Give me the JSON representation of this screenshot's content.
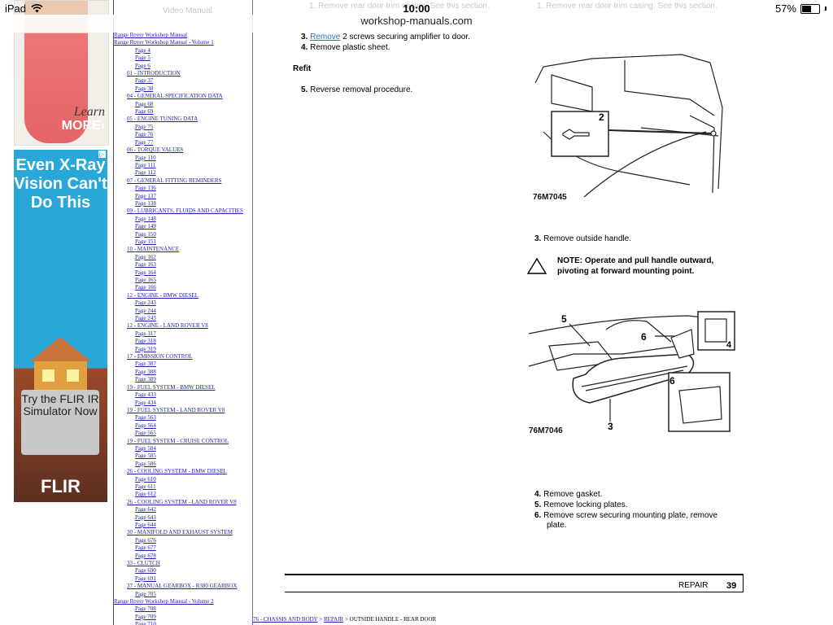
{
  "status_bar": {
    "device": "iPad",
    "time": "10:00",
    "battery": "57%",
    "battery_level": 0.57
  },
  "url_bar": {
    "domain": "workshop-manuals.com"
  },
  "ghost_text": {
    "toc_top": "Video Manual",
    "left": "1. Remove rear door trim casing. See this section.",
    "right": "1. Remove rear door trim casing. See this section."
  },
  "ads": {
    "ad1": {
      "learn": "Learn",
      "more": "MORE›"
    },
    "ad2": {
      "headline": "Even X-Ray Vision Can't Do This",
      "cta": "Try the FLIR IR Simulator Now",
      "brand": "FLIR",
      "choice": "▷"
    }
  },
  "toc": [
    {
      "text": "Range Rover Workshop Manual",
      "level": 0
    },
    {
      "text": "Range Rover Workshop Manual - Volume 1",
      "level": 0
    },
    {
      "text": "Page 4",
      "level": 2
    },
    {
      "text": "Page 5",
      "level": 2
    },
    {
      "text": "Page 6",
      "level": 2
    },
    {
      "text": "01 - INTRODUCTION",
      "level": 1
    },
    {
      "text": "Page 37",
      "level": 2
    },
    {
      "text": "Page 38",
      "level": 2
    },
    {
      "text": "04 - GENERAL SPECIFICATION DATA",
      "level": 1
    },
    {
      "text": "Page 68",
      "level": 2
    },
    {
      "text": "Page 69",
      "level": 2
    },
    {
      "text": "05 - ENGINE TUNING DATA",
      "level": 1
    },
    {
      "text": "Page 75",
      "level": 2
    },
    {
      "text": "Page 76",
      "level": 2
    },
    {
      "text": "Page 77",
      "level": 2
    },
    {
      "text": "06 - TORQUE VALUES",
      "level": 1
    },
    {
      "text": "Page 110",
      "level": 2
    },
    {
      "text": "Page 111",
      "level": 2
    },
    {
      "text": "Page 112",
      "level": 2
    },
    {
      "text": "07 - GENERAL FITTING REMINDERS",
      "level": 1
    },
    {
      "text": "Page 136",
      "level": 2
    },
    {
      "text": "Page 137",
      "level": 2
    },
    {
      "text": "Page 138",
      "level": 2
    },
    {
      "text": "09 - LUBRICANTS, FLUIDS AND CAPACITIES",
      "level": 1
    },
    {
      "text": "Page 148",
      "level": 2
    },
    {
      "text": "Page 149",
      "level": 2
    },
    {
      "text": "Page 150",
      "level": 2
    },
    {
      "text": "Page 151",
      "level": 2
    },
    {
      "text": "10 - MAINTENANCE",
      "level": 1
    },
    {
      "text": "Page 162",
      "level": 2
    },
    {
      "text": "Page 163",
      "level": 2
    },
    {
      "text": "Page 164",
      "level": 2
    },
    {
      "text": "Page 165",
      "level": 2
    },
    {
      "text": "Page 166",
      "level": 2
    },
    {
      "text": "12 - ENGINE - BMW DIESEL",
      "level": 1
    },
    {
      "text": "Page 243",
      "level": 2
    },
    {
      "text": "Page 244",
      "level": 2
    },
    {
      "text": "Page 245",
      "level": 2
    },
    {
      "text": "12 - ENGINE - LAND ROVER V8",
      "level": 1
    },
    {
      "text": "Page 317",
      "level": 2
    },
    {
      "text": "Page 318",
      "level": 2
    },
    {
      "text": "Page 319",
      "level": 2
    },
    {
      "text": "17 - EMISSION CONTROL",
      "level": 1
    },
    {
      "text": "Page 387",
      "level": 2
    },
    {
      "text": "Page 388",
      "level": 2
    },
    {
      "text": "Page 389",
      "level": 2
    },
    {
      "text": "19 - FUEL SYSTEM - BMW DIESEL",
      "level": 1
    },
    {
      "text": "Page 433",
      "level": 2
    },
    {
      "text": "Page 434",
      "level": 2
    },
    {
      "text": "19 - FUEL SYSTEM - LAND ROVER V8",
      "level": 1
    },
    {
      "text": "Page 563",
      "level": 2
    },
    {
      "text": "Page 564",
      "level": 2
    },
    {
      "text": "Page 565",
      "level": 2
    },
    {
      "text": "19 - FUEL SYSTEM - CRUISE CONTROL",
      "level": 1
    },
    {
      "text": "Page 584",
      "level": 2
    },
    {
      "text": "Page 585",
      "level": 2
    },
    {
      "text": "Page 586",
      "level": 2
    },
    {
      "text": "26 - COOLING SYSTEM - BMW DIESEL",
      "level": 1
    },
    {
      "text": "Page 610",
      "level": 2
    },
    {
      "text": "Page 611",
      "level": 2
    },
    {
      "text": "Page 612",
      "level": 2
    },
    {
      "text": "26 - COOLING SYSTEM - LAND ROVER V8",
      "level": 1
    },
    {
      "text": "Page 642",
      "level": 2
    },
    {
      "text": "Page 643",
      "level": 2
    },
    {
      "text": "Page 644",
      "level": 2
    },
    {
      "text": "30 - MANIFOLD AND EXHAUST SYSTEM",
      "level": 1
    },
    {
      "text": "Page 676",
      "level": 2
    },
    {
      "text": "Page 677",
      "level": 2
    },
    {
      "text": "Page 678",
      "level": 2
    },
    {
      "text": "33 - CLUTCH",
      "level": 1
    },
    {
      "text": "Page 690",
      "level": 2
    },
    {
      "text": "Page 691",
      "level": 2
    },
    {
      "text": "37 - MANUAL GEARBOX - R380 GEARBOX",
      "level": 1
    },
    {
      "text": "Page 705",
      "level": 2
    },
    {
      "text": "Range Rover Workshop Manual - Volume 2",
      "level": 0
    },
    {
      "text": "Page 708",
      "level": 2
    },
    {
      "text": "Page 709",
      "level": 2
    },
    {
      "text": "Page 710",
      "level": 2
    }
  ],
  "doc": {
    "step3_num": "3.",
    "step3_link": "Remove",
    "step3_rest": " 2 screws securing amplifier to door.",
    "step4_num": "4.",
    "step4_text": "Remove plastic sheet.",
    "refit_heading": "Refit",
    "refit5_num": "5.",
    "refit5_text": "Reverse removal procedure.",
    "fig1": {
      "id": "76M7045",
      "callout": "2"
    },
    "right_step3_num": "3.",
    "right_step3_text": "Remove outside handle.",
    "note": "NOTE: Operate and pull handle outward, pivoting at forward mounting point.",
    "fig2": {
      "id": "76M7046",
      "callouts": [
        "5",
        "6",
        "4",
        "6",
        "3"
      ]
    },
    "right_steps": [
      {
        "num": "4.",
        "text": "Remove gasket."
      },
      {
        "num": "5.",
        "text": "Remove locking plates."
      },
      {
        "num": "6.",
        "text": "Remove screw securing mounting plate, remove"
      },
      {
        "num": "",
        "text": "plate."
      }
    ],
    "footer": {
      "section": "REPAIR",
      "page": "39"
    }
  },
  "breadcrumb": {
    "link1": "76 - CHASSIS AND BODY",
    "sep": " > ",
    "link2": "REPAIR",
    "current": "OUTSIDE HANDLE - REAR DOOR"
  }
}
